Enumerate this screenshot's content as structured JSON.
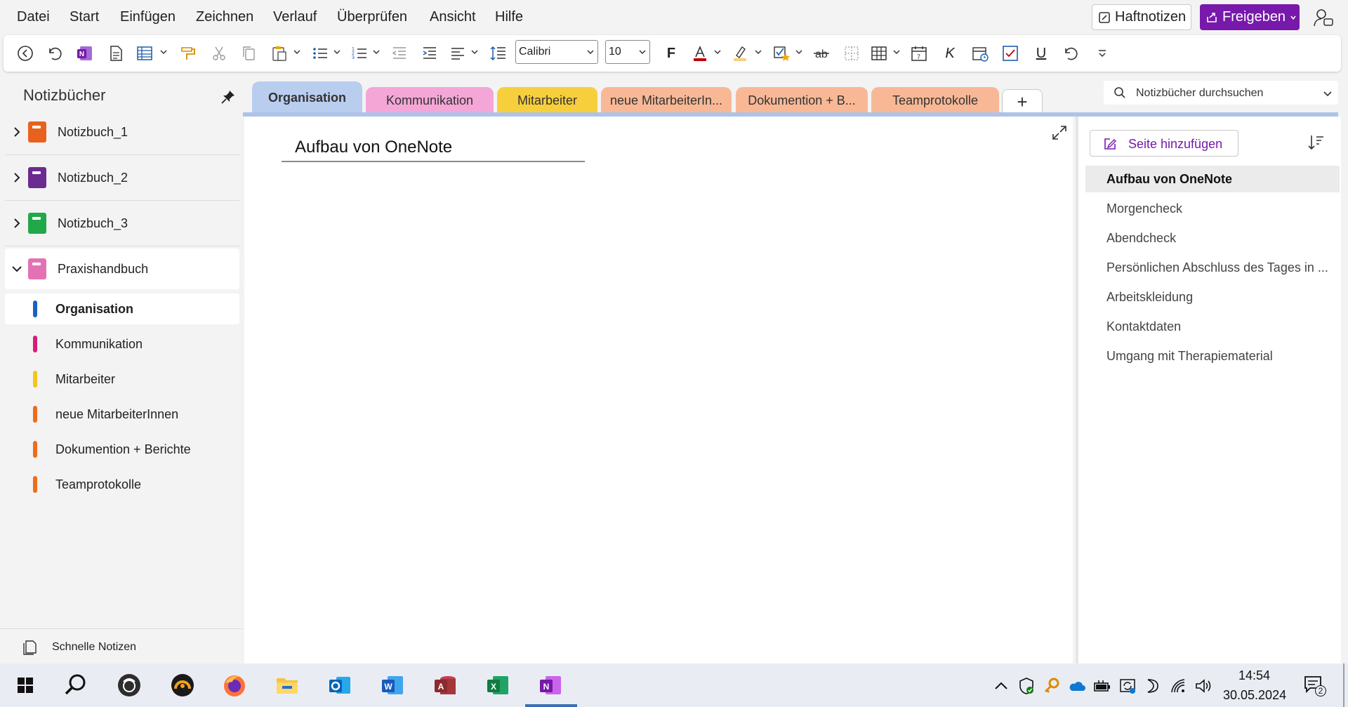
{
  "menu": {
    "items": [
      "Datei",
      "Start",
      "Einfügen",
      "Zeichnen",
      "Verlauf",
      "Überprüfen",
      "Ansicht",
      "Hilfe"
    ],
    "sticky_notes": "Haftnotizen",
    "share": "Freigeben"
  },
  "toolbar": {
    "font_name": "Calibri",
    "font_size": "10",
    "bold": "F",
    "italic": "K",
    "underline": "U",
    "font_color": "#c00000",
    "highlight_color": "#f5d27a"
  },
  "sidebar": {
    "title": "Notizbücher",
    "notebooks": [
      {
        "label": "Notizbuch_1",
        "color": "#e8621e"
      },
      {
        "label": "Notizbuch_2",
        "color": "#6a2c91"
      },
      {
        "label": "Notizbuch_3",
        "color": "#21a84a"
      },
      {
        "label": "Praxishandbuch",
        "color": "#e372b5"
      }
    ],
    "sections": [
      {
        "label": "Organisation",
        "color": "#1565c0"
      },
      {
        "label": "Kommunikation",
        "color": "#d81b7a"
      },
      {
        "label": "Mitarbeiter",
        "color": "#f5c518"
      },
      {
        "label": "neue MitarbeiterInnen",
        "color": "#ef6c1a"
      },
      {
        "label": "Dokumention + Berichte",
        "color": "#ef6c1a"
      },
      {
        "label": "Teamprotokolle",
        "color": "#ef6c1a"
      }
    ],
    "quick_notes": "Schnelle Notizen"
  },
  "tabs": [
    {
      "label": "Organisation",
      "color": "#b9cdef"
    },
    {
      "label": "Kommunikation",
      "color": "#f4a6d7"
    },
    {
      "label": "Mitarbeiter",
      "color": "#f7cf3c"
    },
    {
      "label": "neue MitarbeiterIn...",
      "color": "#f8b896"
    },
    {
      "label": "Dokumention + B...",
      "color": "#f8b896"
    },
    {
      "label": "Teamprotokolle",
      "color": "#f8b896"
    }
  ],
  "search": {
    "placeholder": "Notizbücher durchsuchen"
  },
  "page": {
    "title": "Aufbau von OneNote"
  },
  "pagelist": {
    "add_page": "Seite hinzufügen",
    "pages": [
      "Aufbau von OneNote",
      "Morgencheck",
      "Abendcheck",
      "Persönlichen Abschluss des Tages in ...",
      "Arbeitskleidung",
      "Kontaktdaten",
      "Umgang mit Therapiematerial"
    ]
  },
  "taskbar": {
    "apps": [
      "windows-start-icon",
      "search-icon",
      "app-icon",
      "app-icon",
      "firefox-icon",
      "file-explorer-icon",
      "outlook-icon",
      "word-icon",
      "access-icon",
      "excel-icon",
      "onenote-icon"
    ],
    "time": "14:54",
    "date": "30.05.2024",
    "notification_count": "2"
  }
}
